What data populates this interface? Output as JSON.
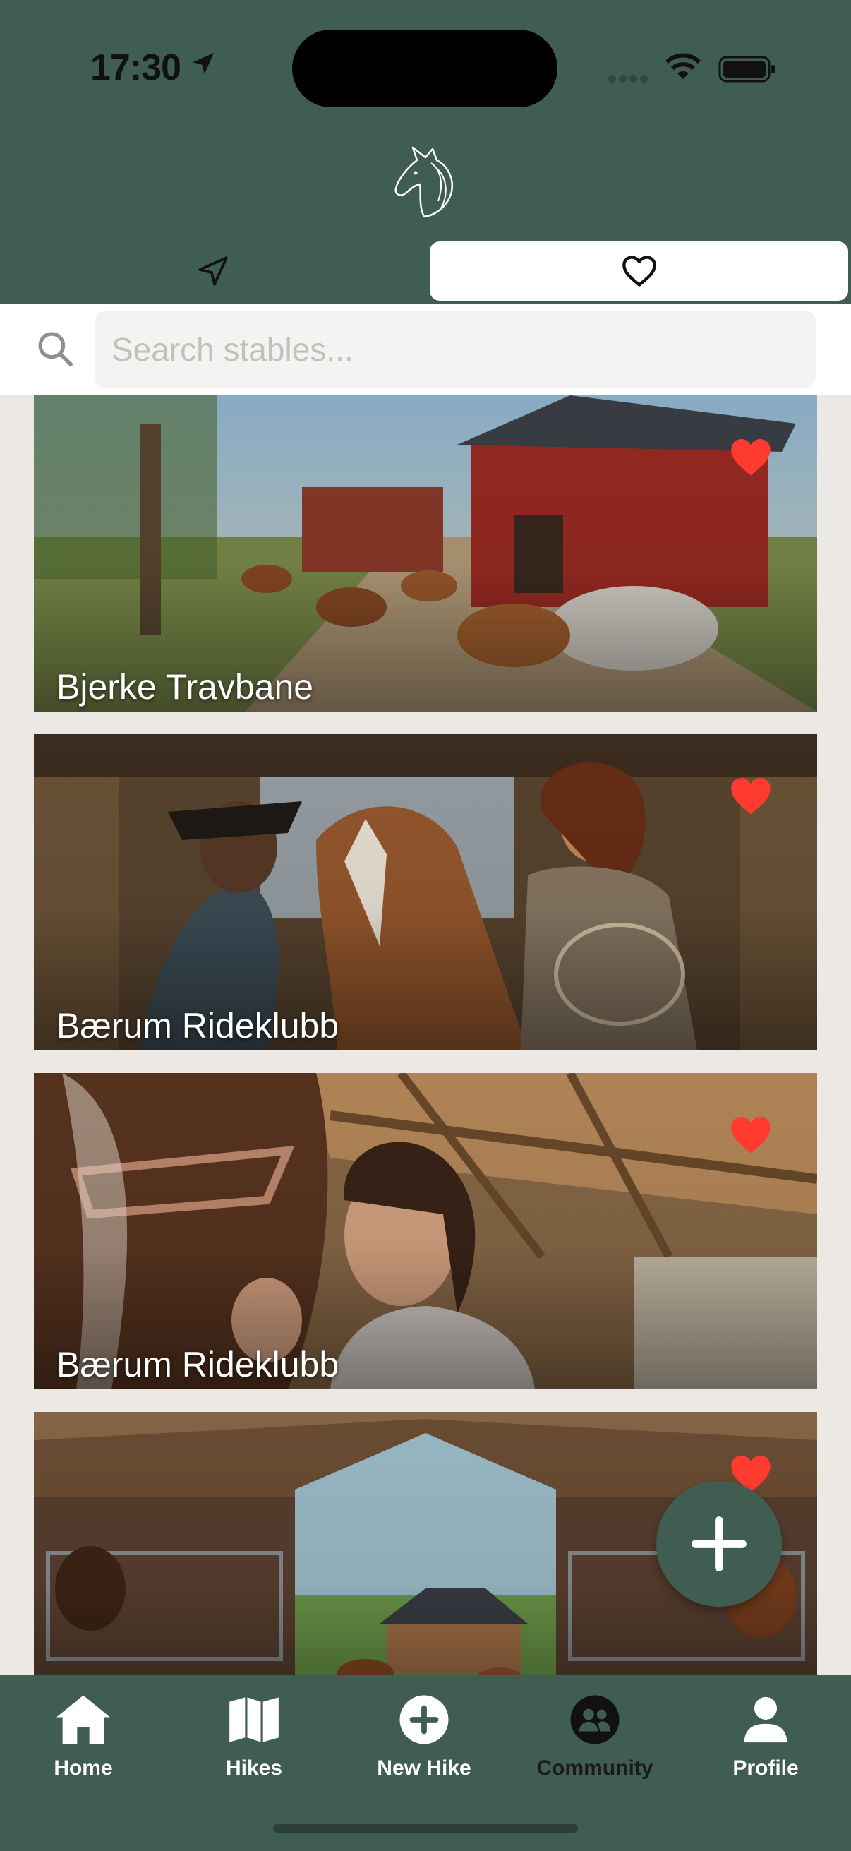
{
  "status_bar": {
    "time": "17:30"
  },
  "header": {
    "logo_icon": "horse-head-icon"
  },
  "segmented": {
    "left_icon": "location-arrow-icon",
    "right_icon": "heart-outline-icon",
    "selected": "favorites"
  },
  "search": {
    "placeholder": "Search stables...",
    "value": ""
  },
  "stables": [
    {
      "name": "Bjerke Travbane",
      "favorite": true
    },
    {
      "name": "Bærum Rideklubb",
      "favorite": true
    },
    {
      "name": "Bærum Rideklubb",
      "favorite": true
    },
    {
      "name": "",
      "favorite": true
    }
  ],
  "fab": {
    "icon": "plus-icon"
  },
  "tabbar": {
    "items": [
      {
        "label": "Home",
        "icon": "home-icon"
      },
      {
        "label": "Hikes",
        "icon": "map-icon"
      },
      {
        "label": "New Hike",
        "icon": "plus-circle-icon"
      },
      {
        "label": "Community",
        "icon": "community-icon"
      },
      {
        "label": "Profile",
        "icon": "person-icon"
      }
    ]
  },
  "colors": {
    "brand": "#3f5d51",
    "heart": "#ff3b30",
    "background": "#ece8e4"
  }
}
